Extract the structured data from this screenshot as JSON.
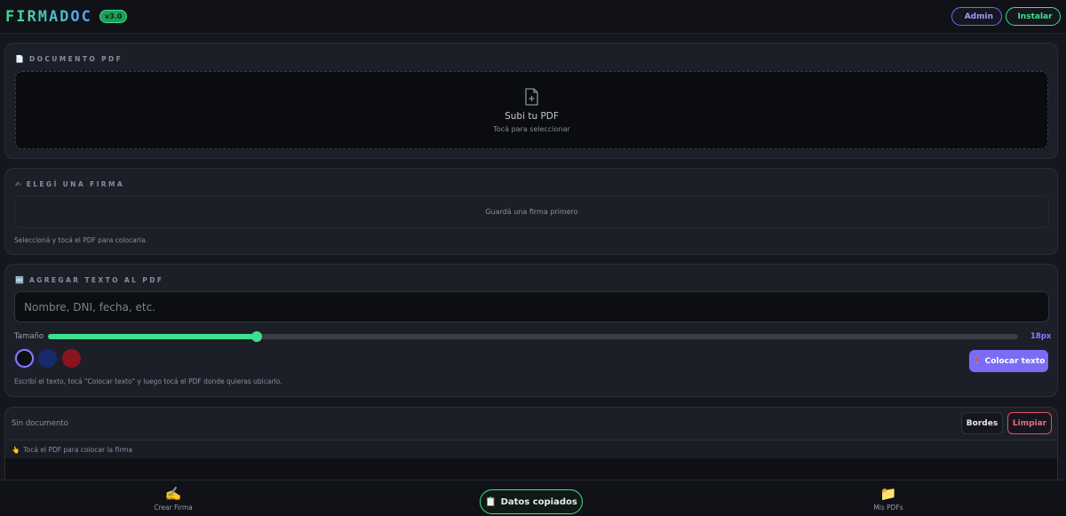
{
  "header": {
    "logo": "FIRMADOC",
    "version": "v3.0",
    "admin_label": "Admin",
    "install_label": "Instalar"
  },
  "pdf_section": {
    "title": "DOCUMENTO PDF",
    "upload_title": "Subi tu PDF",
    "upload_subtitle": "Tocá para seleccionar"
  },
  "signature_section": {
    "title": "ELEGÍ UNA FIRMA",
    "empty_message": "Guardá una firma primero",
    "hint": "Seleccioná y tocá el PDF para colocarla."
  },
  "text_section": {
    "title": "AGREGAR TEXTO AL PDF",
    "input_placeholder": "Nombre, DNI, fecha, etc.",
    "input_value": "",
    "size_label": "Tamaño",
    "size_value": "18px",
    "size_fraction": 0.215,
    "colors": [
      "#0d0e12",
      "#172a6e",
      "#8c1420"
    ],
    "selected_color_index": 0,
    "place_button_label": "Colocar texto",
    "hint": "Escribí el texto, tocá \"Colocar texto\" y luego tocá el PDF donde quieras ubicarlo."
  },
  "viewer": {
    "document_name": "Sin documento",
    "borders_label": "Bordes",
    "clear_label": "Limpiar",
    "tip": "Tocá el PDF para colocar la firma"
  },
  "bottom_nav": {
    "create_signature_label": "Crear Firma",
    "my_pdfs_label": "Mis PDFs"
  },
  "toast": {
    "message": "Datos copiados"
  },
  "colors": {
    "accent_green": "#3ee08f",
    "accent_purple": "#7b6cf6",
    "danger": "#e34d63",
    "background": "#16171e",
    "card": "#1d1f28"
  }
}
